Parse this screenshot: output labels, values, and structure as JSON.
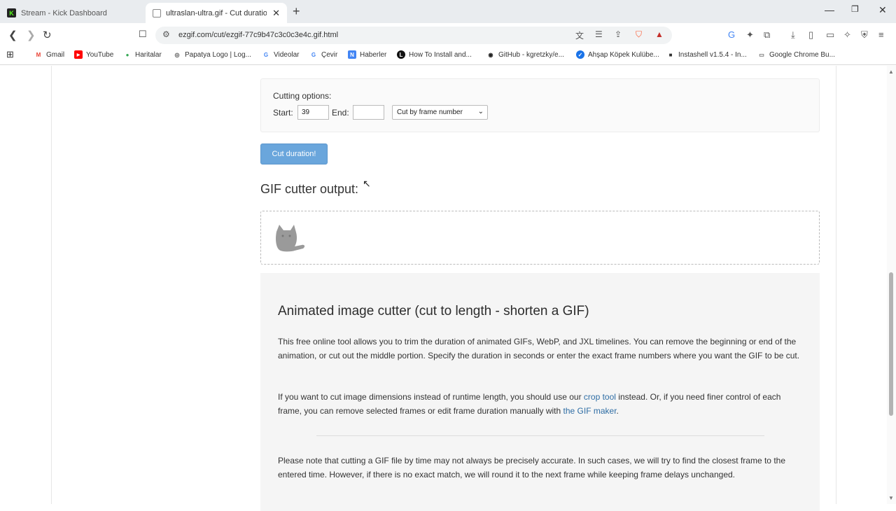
{
  "browser": {
    "tabs": [
      {
        "title": "Stream - Kick Dashboard",
        "favicon": "K"
      },
      {
        "title": "ultraslan-ultra.gif - Cut duration"
      }
    ],
    "new_tab": "+",
    "url": "ezgif.com/cut/ezgif-77c9b47c3c0c3e4c.gif.html"
  },
  "bookmarks": [
    {
      "label": "Gmail",
      "icon": "gmail-icon",
      "color": "#ea4335",
      "glyph": "M"
    },
    {
      "label": "YouTube",
      "icon": "youtube-icon",
      "color": "#ff0000",
      "glyph": "▶"
    },
    {
      "label": "Haritalar",
      "icon": "maps-icon",
      "color": "#34a853",
      "glyph": "●"
    },
    {
      "label": "Papatya Logo | Log...",
      "icon": "papatya-icon",
      "color": "#555555",
      "glyph": "◎"
    },
    {
      "label": "Videolar",
      "icon": "google-icon",
      "color": "#4285f4",
      "glyph": "G"
    },
    {
      "label": "Çevir",
      "icon": "translate-icon",
      "color": "#4285f4",
      "glyph": "G"
    },
    {
      "label": "Haberler",
      "icon": "news-icon",
      "color": "#4285f4",
      "glyph": "N"
    },
    {
      "label": "How To Install and...",
      "icon": "l-icon",
      "color": "#111111",
      "glyph": "L"
    },
    {
      "label": "GitHub - kgretzky/e...",
      "icon": "github-icon",
      "color": "#222222",
      "glyph": "◉"
    },
    {
      "label": "Ahşap Köpek Kulübe...",
      "icon": "check-badge-icon",
      "color": "#1a73e8",
      "glyph": "✓"
    },
    {
      "label": "Instashell v1.5.4 - In...",
      "icon": "instashell-icon",
      "color": "#333333",
      "glyph": "■"
    },
    {
      "label": "Google Chrome Bu...",
      "icon": "folder-icon",
      "color": "#666666",
      "glyph": "▭"
    }
  ],
  "cutting": {
    "title": "Cutting options:",
    "start_label": "Start:",
    "start_value": "39",
    "end_label": "End:",
    "end_value": "",
    "mode_selected": "Cut by frame number",
    "button": "Cut duration!"
  },
  "output": {
    "heading": "GIF cutter output:"
  },
  "info": {
    "heading": "Animated image cutter (cut to length - shorten a GIF)",
    "p1": "This free online tool allows you to trim the duration of animated GIFs, WebP, and JXL timelines. You can remove the beginning or end of the animation, or cut out the middle portion. Specify the duration in seconds or enter the exact frame numbers where you want the GIF to be cut.",
    "p2_a": "If you want to cut image dimensions instead of runtime length, you should use our ",
    "p2_link1": "crop tool",
    "p2_b": " instead. Or, if you need finer control of each frame, you can remove selected frames or edit frame duration manually with ",
    "p2_link2": "the GIF maker",
    "p2_c": ".",
    "p3": "Please note that cutting a GIF file by time may not always be precisely accurate. In such cases, we will try to find the closest frame to the entered time. However, if there is no exact match, we will round it to the next frame while keeping frame delays unchanged."
  }
}
